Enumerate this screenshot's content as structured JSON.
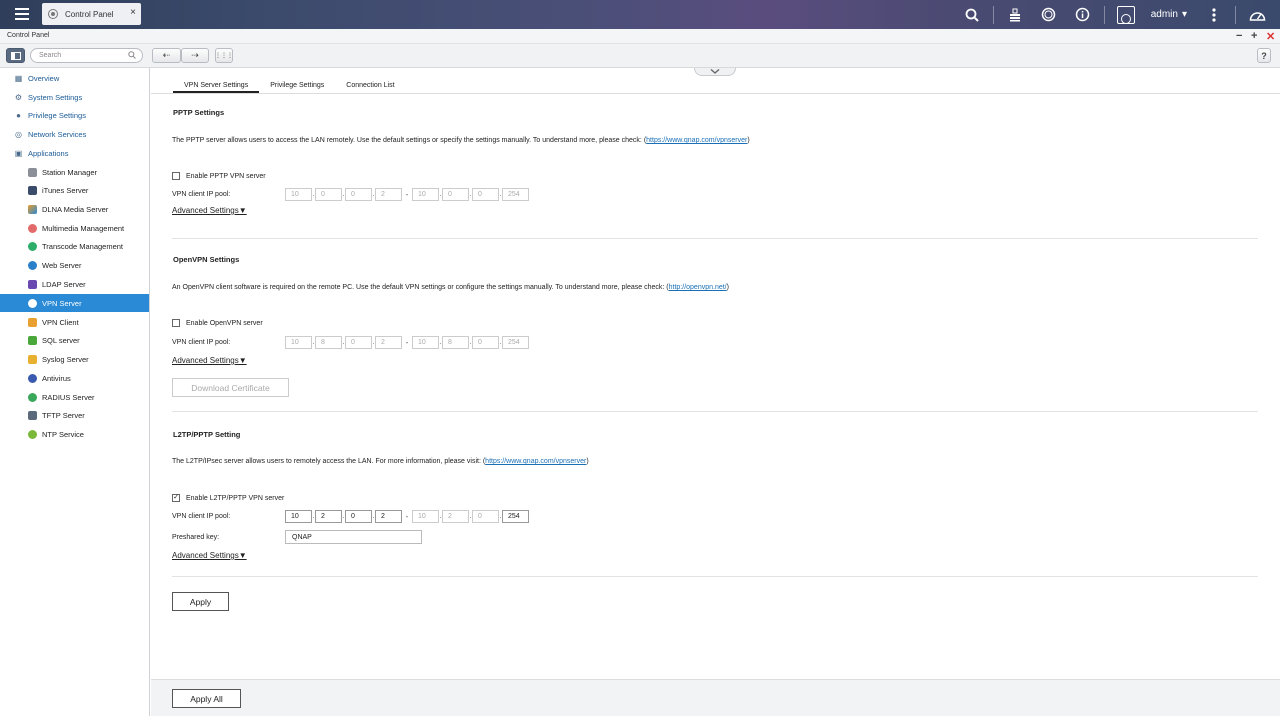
{
  "topbar": {
    "tab_label": "Control Panel",
    "tab_close": "×",
    "user_name": "admin",
    "user_caret": "▾"
  },
  "window": {
    "title": "Control Panel",
    "minimize": "−",
    "maximize": "+",
    "close": "✕"
  },
  "toolbar": {
    "search_placeholder": "Search",
    "back": "⇠",
    "forward": "⇢",
    "grid": "⋮⋮⋮",
    "help": "?"
  },
  "sidebar": {
    "items": [
      {
        "label": "Overview",
        "icon": "overview-icon"
      },
      {
        "label": "System Settings",
        "icon": "gear-icon"
      },
      {
        "label": "Privilege Settings",
        "icon": "user-icon"
      },
      {
        "label": "Network Services",
        "icon": "globe-icon"
      },
      {
        "label": "Applications",
        "icon": "bag-icon"
      }
    ],
    "apps": [
      {
        "label": "Station Manager",
        "color": "#8a8f98"
      },
      {
        "label": "iTunes Server",
        "color": "#3b4b6a"
      },
      {
        "label": "DLNA Media Server",
        "color": "#e79b2c"
      },
      {
        "label": "Multimedia Management",
        "color": "#e36a6a"
      },
      {
        "label": "Transcode Management",
        "color": "#2cae6a"
      },
      {
        "label": "Web Server",
        "color": "#2a7fc9"
      },
      {
        "label": "LDAP Server",
        "color": "#6a4ab0"
      },
      {
        "label": "VPN Server",
        "color": "#ffffff"
      },
      {
        "label": "VPN Client",
        "color": "#e8a030"
      },
      {
        "label": "SQL server",
        "color": "#4aa83a"
      },
      {
        "label": "Syslog Server",
        "color": "#e8b030"
      },
      {
        "label": "Antivirus",
        "color": "#3a5ab0"
      },
      {
        "label": "RADIUS Server",
        "color": "#3aa85a"
      },
      {
        "label": "TFTP Server",
        "color": "#5a6a7a"
      },
      {
        "label": "NTP Service",
        "color": "#7ab83a"
      }
    ]
  },
  "tabs": [
    "VPN Server Settings",
    "Privilege Settings",
    "Connection List"
  ],
  "pptp": {
    "title": "PPTP Settings",
    "desc": "The PPTP server allows users to access the LAN remotely. Use the default settings or specify the settings manually. To understand more, please check: (",
    "link": "https://www.qnap.com/vpnserver",
    "desc_end": ")",
    "enable_label": "Enable PPTP VPN server",
    "pool_label": "VPN client IP pool:",
    "ip_start": [
      "10",
      "0",
      "0",
      "2"
    ],
    "ip_end": [
      "10",
      "0",
      "0",
      "254"
    ],
    "advanced": "Advanced Settings▼"
  },
  "openvpn": {
    "title": "OpenVPN Settings",
    "desc": "An OpenVPN client software is required on the remote PC. Use the default VPN settings or configure the settings manually. To understand more, please check: (",
    "link": "http://openvpn.net/",
    "desc_end": ")",
    "enable_label": "Enable OpenVPN server",
    "pool_label": "VPN client IP pool:",
    "ip_start": [
      "10",
      "8",
      "0",
      "2"
    ],
    "ip_end": [
      "10",
      "8",
      "0",
      "254"
    ],
    "advanced": "Advanced Settings▼",
    "download": "Download Certificate"
  },
  "l2tp": {
    "title": "L2TP/PPTP Setting",
    "desc": "The L2TP/IPsec server allows users to remotely access the LAN. For more information, please visit: (",
    "link": "https://www.qnap.com/vpnserver",
    "desc_end": ")",
    "enable_label": "Enable L2TP/PPTP VPN server",
    "enabled": true,
    "check_mark": "✓",
    "pool_label": "VPN client IP pool:",
    "ip_start": [
      "10",
      "2",
      "0",
      "2"
    ],
    "ip_end": [
      "10",
      "2",
      "0",
      "254"
    ],
    "key_label": "Preshared key:",
    "key_value": "QNAP",
    "advanced": "Advanced Settings▼"
  },
  "apply": "Apply",
  "apply_all": "Apply All"
}
